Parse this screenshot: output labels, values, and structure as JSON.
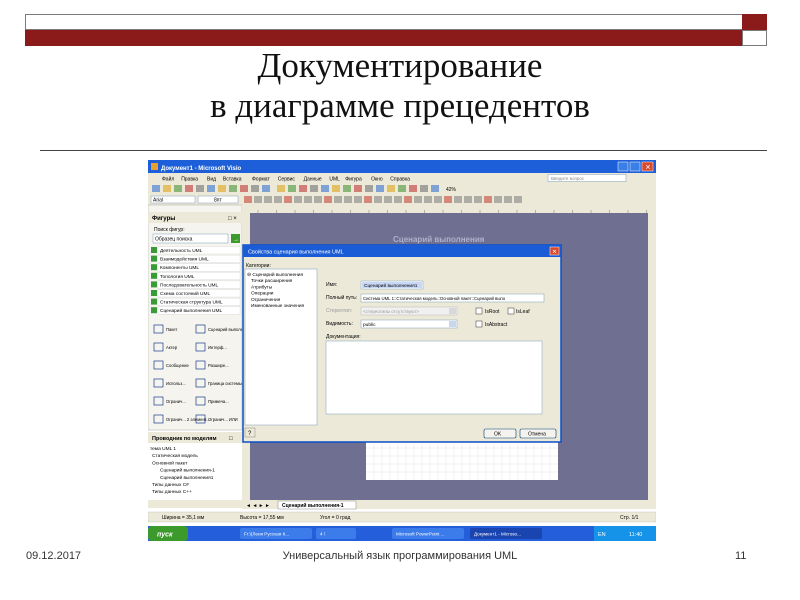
{
  "slide": {
    "title_line1": "Документирование",
    "title_line2": "в диаграмме прецедентов",
    "footer_date": "09.12.2017",
    "footer_center": "Универсальный  язык программирования UML",
    "slide_number": "11"
  },
  "app": {
    "window_title": "Документ1 - Microsoft Visio",
    "menu": [
      "Файл",
      "Правка",
      "Вид",
      "Вставка",
      "Формат",
      "Сервис",
      "Данные",
      "UML",
      "Фигура",
      "Окно",
      "Справка"
    ],
    "help_placeholder": "Введите вопрос",
    "font_name": "Arial",
    "font_size": "8пт",
    "zoom": "42%",
    "shapes_panel_title": "Фигуры",
    "shape_search_label": "Поиск фигур:",
    "shape_search_placeholder": "Образец поиска",
    "stencils": [
      "Деятельность UML",
      "Взаимодействия UML",
      "Компоненты UML",
      "Топология UML",
      "Последовательность UML",
      "Схема состояний UML",
      "Статическая структура UML",
      "Сценарий выполнения UML"
    ],
    "shapes": [
      [
        "Пакет",
        "Сценарий выполн..."
      ],
      [
        "Актер",
        "Интерф..."
      ],
      [
        "Сообщение",
        "Разшире..."
      ],
      [
        "Использ...",
        "Граница системы"
      ],
      [
        "Огранич...",
        "Примеча..."
      ],
      [
        "Огранич... 2 элемент...",
        "Огранич... ИЛИ"
      ]
    ],
    "model_explorer_title": "Проводник по моделям",
    "model_tree": [
      "тема UML 1",
      "Статическая модель",
      "Основной пакет",
      "Сценарий выполнения-1",
      "Сценарий выполнения1",
      "Типы данных C#",
      "Типы данных C++"
    ],
    "canvas_heading": "Сценарий выполнения",
    "page_tab": "Сценарий выполнения-1",
    "status_width": "Ширина = 35,1 мм",
    "status_height": "Высота = 17,55 мм",
    "status_angle": "Угол = 0 град",
    "status_page": "Стр. 1/1",
    "taskbar_start": "пуск",
    "taskbar_items": [
      "Fr:\\(Леня Русская К...",
      "4 \\",
      "Microsoft PowerPoint ...",
      "Документ1 - Microso..."
    ],
    "taskbar_lang": "EN",
    "taskbar_time": "11:40"
  },
  "dialog": {
    "title": "Свойства сценария выполнения UML",
    "categories_label": "Категории:",
    "categories": [
      "Сценарий выполнения",
      "Точки расширения",
      "Атрибуты",
      "Операции",
      "Ограничения",
      "Именованные значения"
    ],
    "name_label": "Имя:",
    "name_value": "Сценарий выполнения1",
    "full_path_label": "Полный путь:",
    "full_path_value": "Система UML 1::Статическая модель::Основной пакет::Сценарий выпо",
    "stereotype_label": "Стереотип:",
    "stereotype_value": "<стереотипы отсутствуют>",
    "visibility_label": "Видимость:",
    "visibility_value": "public",
    "is_root_label": "IsRoot",
    "is_leaf_label": "IsLeaf",
    "is_abstract_label": "IsAbstract",
    "documentation_label": "Документация:",
    "ok_label": "OK",
    "cancel_label": "Отмена",
    "help_label": "?"
  },
  "colors": {
    "band_dark_red": "#8b1a1a",
    "xp_blue": "#0a4fc8",
    "xp_title_gradient": "#3a7ee8",
    "canvas_bg": "#6f6f92",
    "stencil_green": "#3a9a3a",
    "start_green": "#3c9a2c"
  }
}
